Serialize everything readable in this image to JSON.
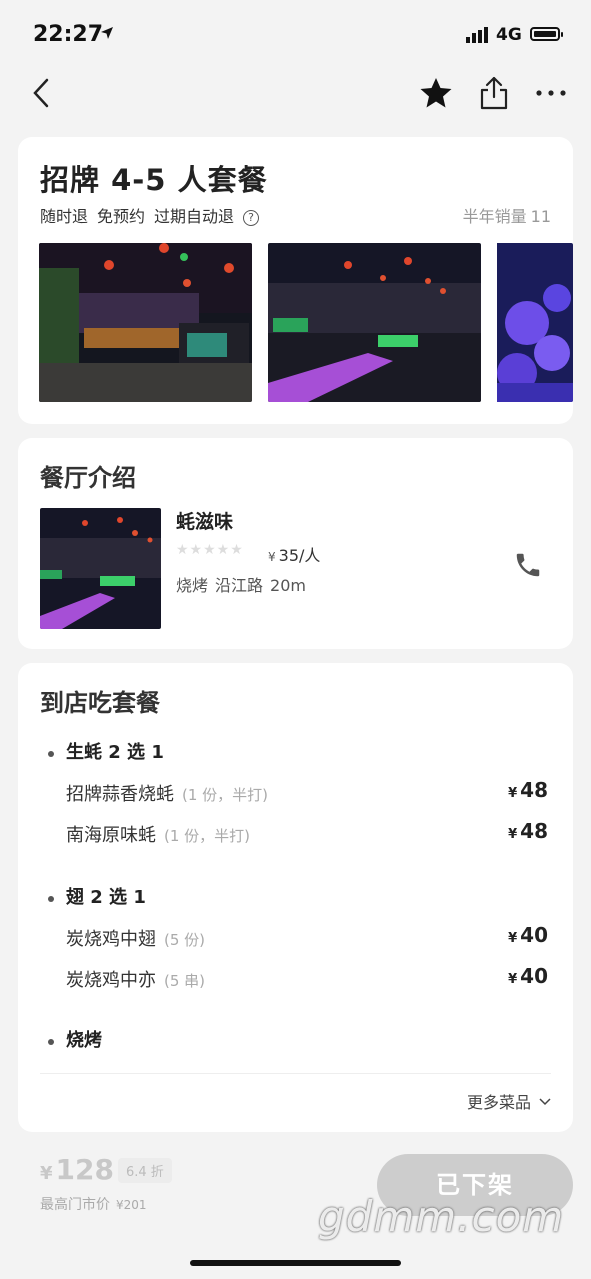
{
  "status_bar": {
    "time": "22:27",
    "network": "4G"
  },
  "deal": {
    "title": "招牌 4-5 人套餐",
    "tags": [
      "随时退",
      "免预约",
      "过期自动退"
    ],
    "help_glyph": "?",
    "sales_label": "半年销量",
    "sales_value": "11"
  },
  "restaurant": {
    "section_title": "餐厅介绍",
    "name": "蚝滋味",
    "rating_stars": "★★★★★",
    "currency": "¥",
    "price_per_person": "35/人",
    "category": "烧烤",
    "area": "沿江路",
    "distance": "20m"
  },
  "menu": {
    "section_title": "到店吃套餐",
    "groups": [
      {
        "title": "生蚝 2 选 1",
        "items": [
          {
            "name": "招牌蒜香烧蚝",
            "note": "(1 份，半打)",
            "currency": "¥",
            "price": "48"
          },
          {
            "name": "南海原味蚝",
            "note": "(1 份，半打)",
            "currency": "¥",
            "price": "48"
          }
        ]
      },
      {
        "title": "翅 2 选 1",
        "items": [
          {
            "name": "炭烧鸡中翅",
            "note": "(5 份)",
            "currency": "¥",
            "price": "40"
          },
          {
            "name": "炭烧鸡中亦",
            "note": "(5 串)",
            "currency": "¥",
            "price": "40"
          }
        ]
      },
      {
        "title": "烧烤",
        "items": []
      }
    ],
    "more_label": "更多菜品"
  },
  "bottom_bar": {
    "currency": "¥",
    "price": "128",
    "discount": "6.4 折",
    "market_label": "最高门市价",
    "market_price": "¥201",
    "action_label": "已下架"
  },
  "watermark": "gdmm.com",
  "icons": {
    "back": "chevron-left-icon",
    "favorite": "star-icon",
    "share": "share-icon",
    "more": "more-icon",
    "phone": "phone-icon",
    "expand": "chevron-down-icon"
  },
  "colors": {
    "background": "#f3f3f3",
    "card": "#ffffff",
    "muted": "#999999",
    "disabled_button": "#cdcdcd"
  }
}
